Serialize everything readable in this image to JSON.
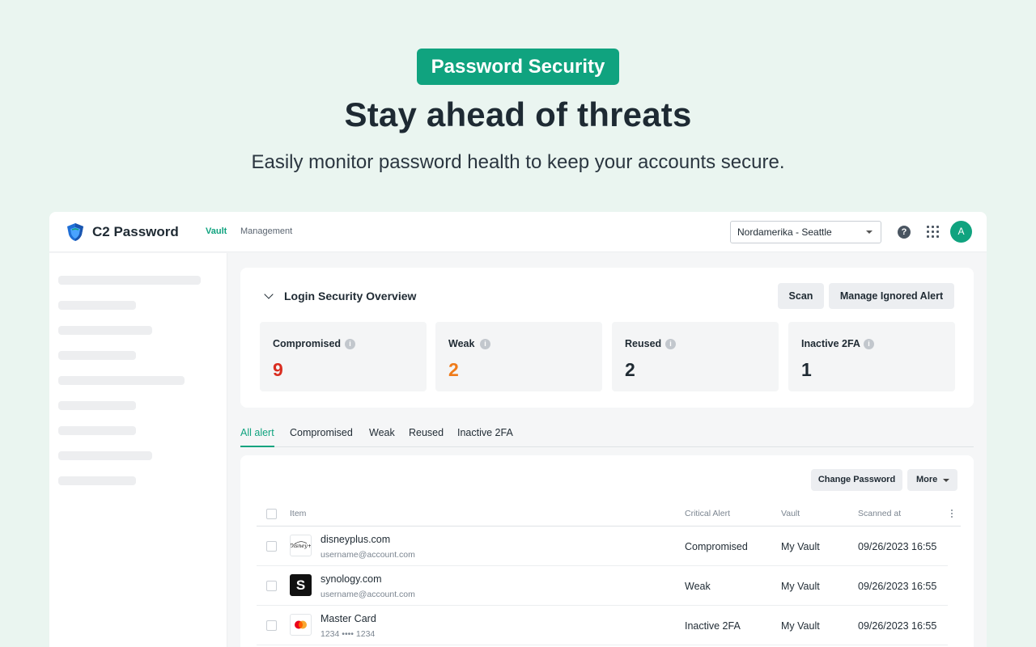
{
  "hero": {
    "badge": "Password Security",
    "title": "Stay ahead of threats",
    "subtitle": "Easily monitor password health to keep your accounts secure."
  },
  "app": {
    "name": "C2 Password",
    "nav": {
      "vault": "Vault",
      "management": "Management"
    },
    "location": "Nordamerika - Seattle",
    "help_glyph": "?",
    "avatar_initial": "A",
    "icons": [
      "shield-logo-icon",
      "help-icon",
      "apps-grid-icon",
      "chevron-down-icon",
      "info-icon",
      "kebab-icon"
    ]
  },
  "overview": {
    "title": "Login Security Overview",
    "scan_label": "Scan",
    "manage_label": "Manage Ignored Alert",
    "stats": [
      {
        "label": "Compromised",
        "value": "9",
        "color": "#d92d20"
      },
      {
        "label": "Weak",
        "value": "2",
        "color": "#ef7b1a"
      },
      {
        "label": "Reused",
        "value": "2",
        "color": "#1f2a33"
      },
      {
        "label": "Inactive 2FA",
        "value": "1",
        "color": "#1f2a33"
      }
    ]
  },
  "tabs": [
    "All alert",
    "Compromised",
    "Weak",
    "Reused",
    "Inactive 2FA"
  ],
  "table": {
    "change_password_label": "Change Password",
    "more_label": "More",
    "headers": {
      "item": "Item",
      "critical_alert": "Critical Alert",
      "vault": "Vault",
      "scanned_at": "Scanned at"
    },
    "rows": [
      {
        "name": "disneyplus.com",
        "sub": "username@account.com",
        "alert": "Compromised",
        "vault": "My Vault",
        "scanned": "09/26/2023 16:55",
        "logo": "Disney+"
      },
      {
        "name": "synology.com",
        "sub": "username@account.com",
        "alert": "Weak",
        "vault": "My Vault",
        "scanned": "09/26/2023 16:55",
        "logo": "S"
      },
      {
        "name": "Master Card",
        "sub": "1234 •••• 1234",
        "alert": "Inactive 2FA",
        "vault": "My Vault",
        "scanned": "09/26/2023 16:55",
        "logo": "mastercard"
      }
    ]
  },
  "colors": {
    "accent": "#10a37f",
    "background": "#eaf5f0"
  }
}
